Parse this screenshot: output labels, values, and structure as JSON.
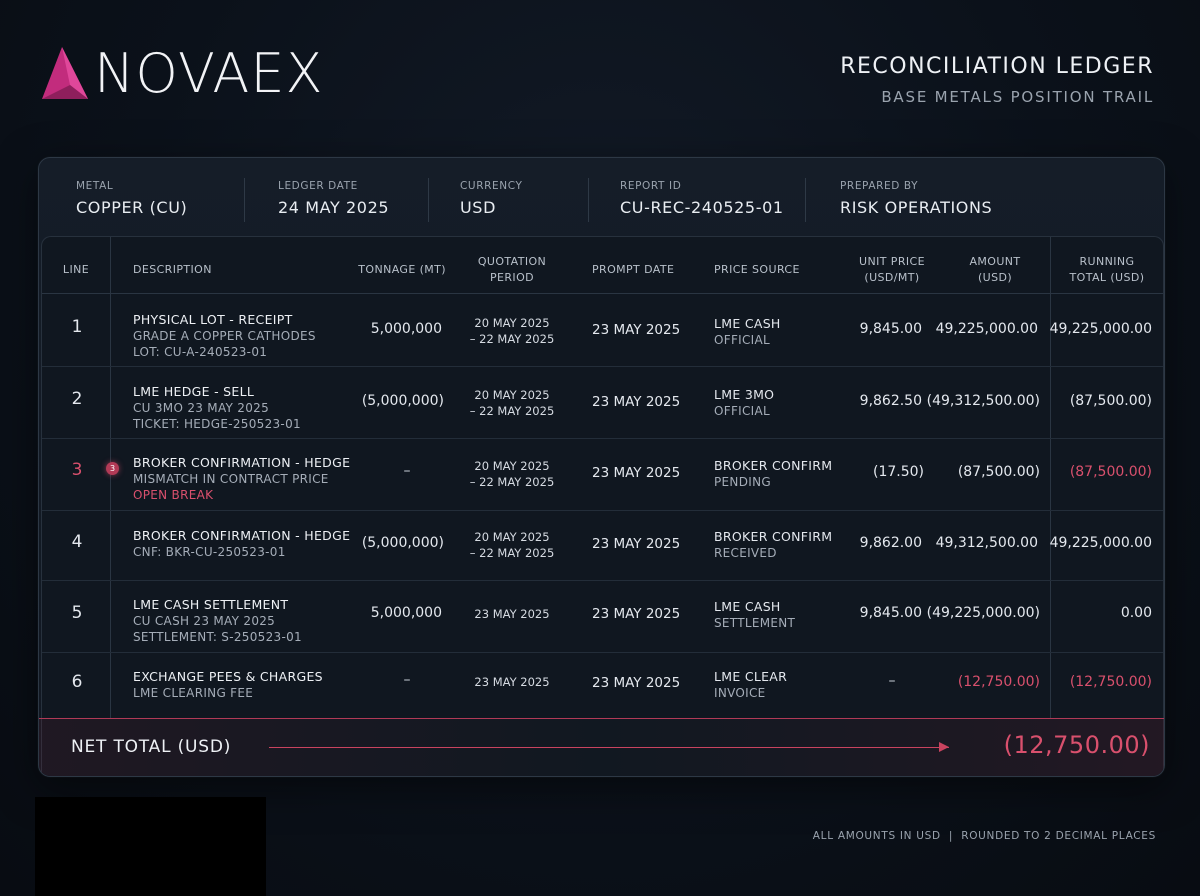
{
  "brand": {
    "name": "NOVAEX",
    "accent": "#d4338a"
  },
  "header": {
    "title": "RECONCILIATION LEDGER",
    "subtitle": "BASE METALS POSITION TRAIL"
  },
  "meta": [
    {
      "label": "METAL",
      "value": "COPPER (CU)"
    },
    {
      "label": "LEDGER DATE",
      "value": "24 MAY 2025"
    },
    {
      "label": "CURRENCY",
      "value": "USD"
    },
    {
      "label": "REPORT ID",
      "value": "CU-REC-240525-01"
    },
    {
      "label": "PREPARED BY",
      "value": "RISK OPERATIONS"
    }
  ],
  "columns": {
    "line": "LINE",
    "description": "DESCRIPTION",
    "tonnage": "TONNAGE (MT)",
    "qp1": "QUOTATION",
    "qp2": "PERIOD",
    "prompt": "PROMPT DATE",
    "source": "PRICE SOURCE",
    "unit1": "UNIT PRICE",
    "unit2": "(USD/MT)",
    "amount1": "AMOUNT",
    "amount2": "(USD)",
    "running1": "RUNNING",
    "running2": "TOTAL (USD)"
  },
  "rows": [
    {
      "line": "1",
      "desc1": "PHYSICAL LOT - RECEIPT",
      "desc2": "GRADE A COPPER CATHODES",
      "desc3": "LOT: CU-A-240523-01",
      "tonnage": "5,000,000",
      "qp1": "20 MAY 2025",
      "qp2": "– 22 MAY 2025",
      "prompt": "23 MAY 2025",
      "src1": "LME CASH",
      "src2": "OFFICIAL",
      "unit": "9,845.00",
      "amount": "49,225,000.00",
      "running": "49,225,000.00"
    },
    {
      "line": "2",
      "desc1": "LME HEDGE - SELL",
      "desc2": "CU 3MO 23 MAY 2025",
      "desc3": "TICKET: HEDGE-250523-01",
      "tonnage": "(5,000,000)",
      "qp1": "20 MAY 2025",
      "qp2": "– 22 MAY 2025",
      "prompt": "23 MAY 2025",
      "src1": "LME 3MO",
      "src2": "OFFICIAL",
      "unit": "9,862.50",
      "amount": "(49,312,500.00)",
      "running": "(87,500.00)"
    },
    {
      "line": "3",
      "badge": "3",
      "desc1": "BROKER CONFIRMATION - HEDGE",
      "desc2": "MISMATCH IN CONTRACT PRICE",
      "flag": "OPEN BREAK",
      "tonnage": "–",
      "qp1": "20 MAY 2025",
      "qp2": "– 22 MAY 2025",
      "prompt": "23 MAY 2025",
      "src1": "BROKER CONFIRM",
      "src2": "PENDING",
      "unit": "(17.50)",
      "amount": "(87,500.00)",
      "running": "(87,500.00)"
    },
    {
      "line": "4",
      "desc1": "BROKER CONFIRMATION - HEDGE",
      "desc2": "CNF: BKR-CU-250523-01",
      "tonnage": "(5,000,000)",
      "qp1": "20 MAY 2025",
      "qp2": "– 22 MAY 2025",
      "prompt": "23 MAY 2025",
      "src1": "BROKER CONFIRM",
      "src2": "RECEIVED",
      "unit": "9,862.00",
      "amount": "49,312,500.00",
      "running": "49,225,000.00"
    },
    {
      "line": "5",
      "desc1": "LME CASH SETTLEMENT",
      "desc2": "CU CASH 23 MAY 2025",
      "desc3": "SETTLEMENT: S-250523-01",
      "tonnage": "5,000,000",
      "qp1": "23 MAY 2025",
      "prompt": "23 MAY 2025",
      "src1": "LME CASH",
      "src2": "SETTLEMENT",
      "unit": "9,845.00",
      "amount": "(49,225,000.00)",
      "running": "0.00"
    },
    {
      "line": "6",
      "desc1": "EXCHANGE PEES & CHARGES",
      "desc2": "LME CLEARING FEE",
      "tonnage": "–",
      "qp1": "23 MAY 2025",
      "prompt": "23 MAY 2025",
      "src1": "LME CLEAR",
      "src2": "INVOICE",
      "unit": "–",
      "amount": "(12,750.00)",
      "running": "(12,750.00)"
    }
  ],
  "net": {
    "label": "NET TOTAL (USD)",
    "value": "(12,750.00)"
  },
  "footer": "ALL AMOUNTS IN USD  |  ROUNDED TO 2 DECIMAL PLACES"
}
